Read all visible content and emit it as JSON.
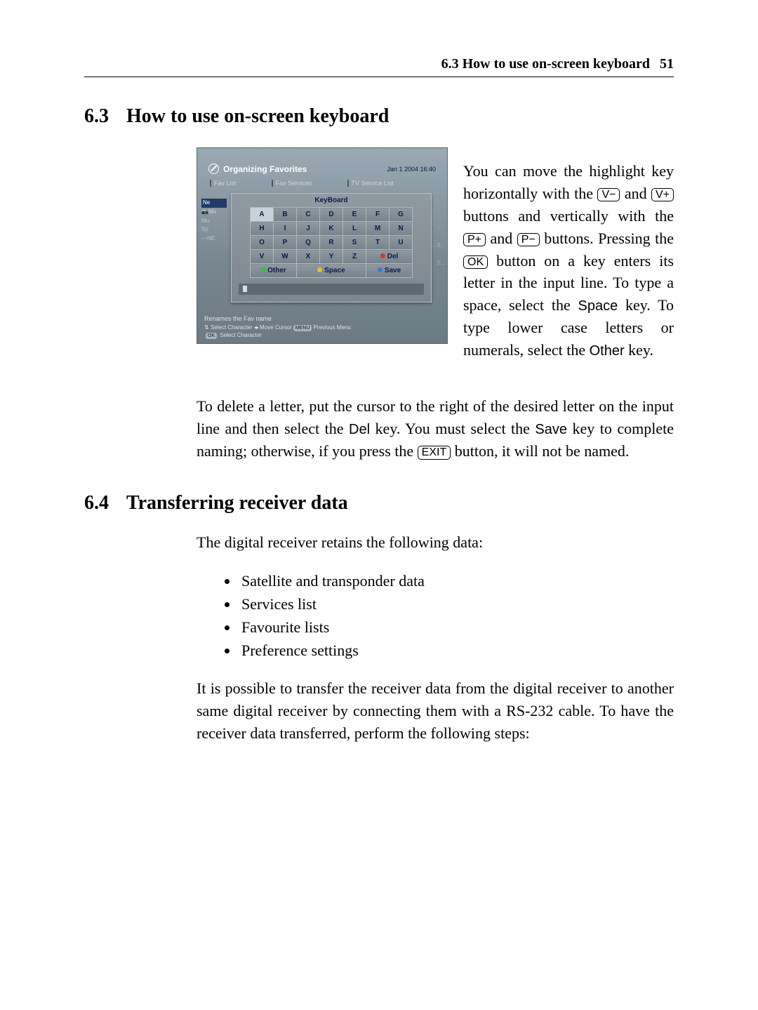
{
  "page": {
    "running_head_left": "6.3 How to use on-screen keyboard",
    "page_number": "51"
  },
  "section63": {
    "number": "6.3",
    "title": "How to use on-screen keyboard",
    "para1_a": "You can move the highlight key horizontally with the ",
    "key_vminus": "V−",
    "para1_b": " and ",
    "key_vplus": "V+",
    "para1_c": " buttons and vertically with the ",
    "key_pplus": "P+",
    "para1_d": " and ",
    "key_pminus": "P−",
    "para1_e": " buttons. Pressing the ",
    "key_ok": "OK",
    "para1_f": " button on a key enters its letter in the input line. To type a space, select the ",
    "sf_space": "Space",
    "para1_g": " key. To type lower case letters or numerals, select the ",
    "sf_other": "Other",
    "para1_h": " key.",
    "para2_a": "To delete a letter, put the cursor to the right of the desired letter on the input line and then select the ",
    "sf_del": "Del",
    "para2_b": " key. You must select the ",
    "sf_save": "Save",
    "para2_c": " key to complete naming; otherwise, if you press the ",
    "key_exit": "EXIT",
    "para2_d": " button, it will not be named."
  },
  "section64": {
    "number": "6.4",
    "title": "Transferring receiver data",
    "intro": "The digital receiver retains the following data:",
    "items": {
      "0": "Satellite and transponder data",
      "1": "Services list",
      "2": "Favourite lists",
      "3": "Preference settings"
    },
    "outro": "It is possible to transfer the receiver data from the digital receiver to another same digital receiver by connecting them with a RS-232 cable. To have the receiver data transferred, perform the following steps:"
  },
  "screenshot": {
    "title": "Organizing Favorites",
    "timestamp": "Jan 1 2004 16:40",
    "tabs": {
      "0": "Fav List",
      "1": "Fav Services",
      "2": "TV Service List"
    },
    "side": {
      "0": "Ne",
      "1": "Mo",
      "2": "Mu",
      "3": "Sp",
      "4": "---NE"
    },
    "side_r": {
      "0": "...",
      "1": "0...",
      "2": "0..."
    },
    "kb_title": "KeyBoard",
    "keys": {
      "r0": {
        "0": "A",
        "1": "B",
        "2": "C",
        "3": "D",
        "4": "E",
        "5": "F",
        "6": "G"
      },
      "r1": {
        "0": "H",
        "1": "I",
        "2": "J",
        "3": "K",
        "4": "L",
        "5": "M",
        "6": "N"
      },
      "r2": {
        "0": "O",
        "1": "P",
        "2": "Q",
        "3": "R",
        "4": "S",
        "5": "T",
        "6": "U"
      },
      "r3": {
        "0": "V",
        "1": "W",
        "2": "X",
        "3": "Y",
        "4": "Z"
      }
    },
    "actions": {
      "other": "Other",
      "space": "Space",
      "del": "Del",
      "save": "Save"
    },
    "status": "Renames the Fav name",
    "help": {
      "line1a": "Select Character",
      "line1b": "Move Cursor",
      "menu_pill": "MENU",
      "line1c": "Previous Menu",
      "ok_pill": "OK",
      "line2": "Select Character"
    }
  }
}
